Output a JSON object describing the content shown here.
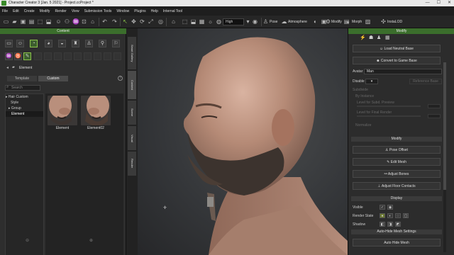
{
  "window": {
    "title": "Character Creator 3 [Jan. 5 2021] - Project.ccProject *",
    "minimize": "—",
    "maximize": "☐",
    "close": "✕"
  },
  "menu": [
    "File",
    "Edit",
    "Create",
    "Modify",
    "Render",
    "View",
    "Submission Tools",
    "Window",
    "Plugins",
    "Help",
    "Internal Tool"
  ],
  "toolbar": {
    "quality": "High",
    "pose_label": "Pose",
    "atmosphere_label": "Atmosphere",
    "modify_label": "Modify",
    "morph_label": "Morph",
    "instalod_label": "InstaLOD"
  },
  "content_panel": {
    "title": "Content",
    "tabs": [
      "Template",
      "Custom"
    ],
    "active_tab": "Custom",
    "breadcrumb": "Element",
    "search_placeholder": "Search",
    "tree": [
      {
        "label": "Hair Custom",
        "prefix": "▸",
        "selected": false
      },
      {
        "label": "Style",
        "prefix": "",
        "selected": false
      },
      {
        "label": "Group",
        "prefix": "▸",
        "selected": false
      },
      {
        "label": "Element",
        "prefix": "",
        "selected": true
      }
    ],
    "items": [
      {
        "label": "Element"
      },
      {
        "label": "Element02"
      }
    ]
  },
  "side_tabs": [
    "Smart Gallery",
    "Content",
    "Scene",
    "Visual",
    "Render"
  ],
  "modify_panel": {
    "title": "Modify",
    "load_neutral_base": "Load Neutral Base",
    "convert_to_game_base": "Convert to Game Base",
    "avatar_label": "Avatar",
    "avatar_value": "Man",
    "disable_label": "Disable",
    "disable_value": "▾",
    "reference_label": "Reference Base",
    "subdivide_label": "Subdivide",
    "by_instance_label": "By Instance",
    "level_label": "Level for Subd. Preview",
    "level_render_label": "Level for Final Render",
    "normalize_label": "Normalize",
    "section_modify": "Modify",
    "pose_offset": "Pose Offset",
    "edit_mesh": "Edit Mesh",
    "adjust_bones": "Adjust Bones",
    "adjust_floor_contacts": "Adjust Floor Contacts",
    "section_display": "Display",
    "visible_label": "Visible",
    "render_state_label": "Render State",
    "shadow_label": "Shadow",
    "section_auto_hide": "Auto-Hide Mesh Settings",
    "auto_hide_mesh": "Auto Hide Mesh"
  },
  "colors": {
    "accent": "#3b6e2c",
    "highlight": "#8bc34a",
    "background": "#2b2b2b"
  }
}
